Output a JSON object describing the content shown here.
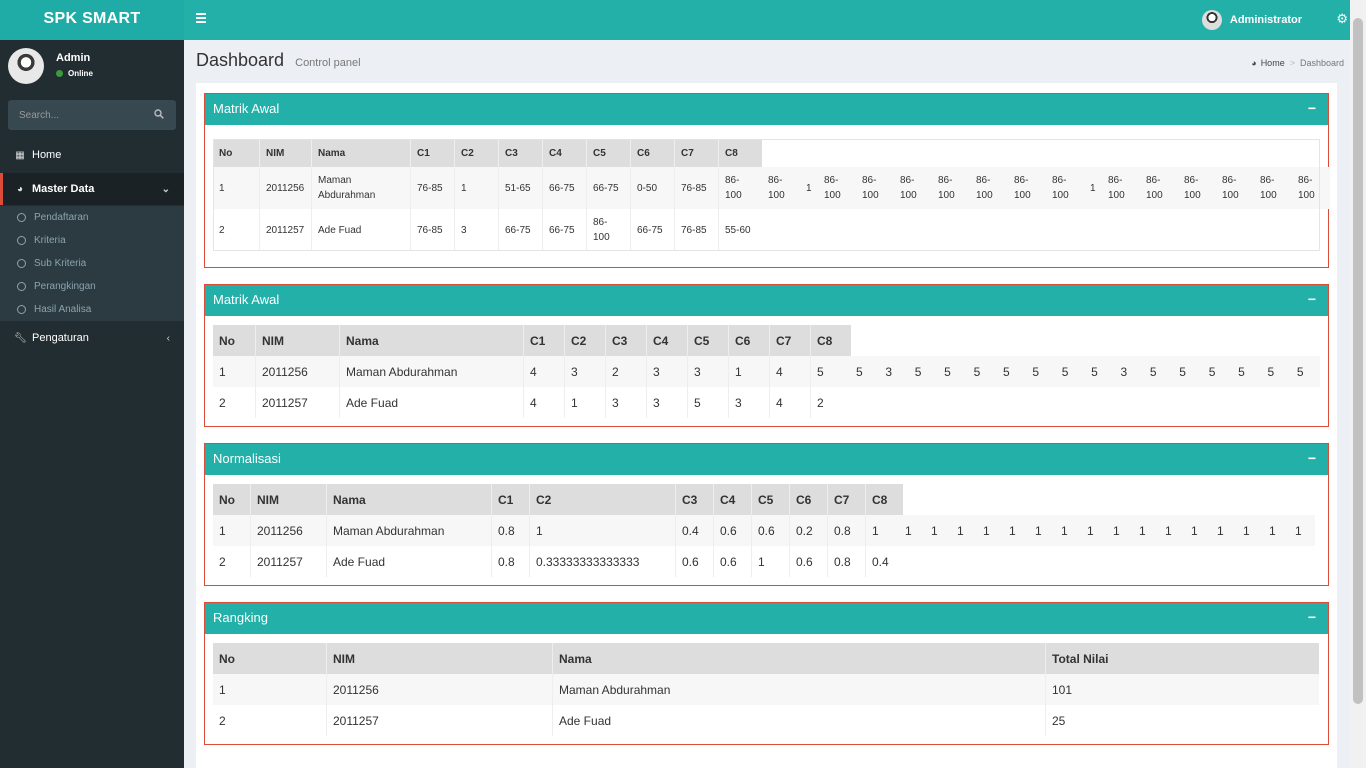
{
  "app": {
    "brand": "SPK SMART"
  },
  "navbar": {
    "user_label": "Administrator"
  },
  "sidebar": {
    "user": {
      "name": "Admin",
      "status": "Online"
    },
    "search_placeholder": "Search...",
    "home_label": "Home",
    "master_label": "Master Data",
    "submenu": [
      "Pendaftaran",
      "Kriteria",
      "Sub Kriteria",
      "Perangkingan",
      "Hasil Analisa"
    ],
    "settings_label": "Pengaturan"
  },
  "page": {
    "title": "Dashboard",
    "subtitle": "Control panel"
  },
  "breadcrumb": {
    "home": "Home",
    "current": "Dashboard"
  },
  "boxes": {
    "matrik_awal_1": {
      "title": "Matrik Awal",
      "headers": [
        "No",
        "NIM",
        "Nama",
        "C1",
        "C2",
        "C3",
        "C4",
        "C5",
        "C6",
        "C7",
        "C8"
      ],
      "rows": [
        [
          "1",
          "2011256",
          "Maman Abdurahman",
          "76-85",
          "1",
          "51-65",
          "66-75",
          "66-75",
          "0-50",
          "76-85",
          "86-100"
        ],
        [
          "2",
          "2011257",
          "Ade Fuad",
          "76-85",
          "3",
          "66-75",
          "66-75",
          "86-100",
          "66-75",
          "76-85",
          "55-60"
        ]
      ],
      "extra": [
        "86-100",
        "1",
        "86-100",
        "86-100",
        "86-100",
        "86-100",
        "86-100",
        "86-100",
        "86-100",
        "1",
        "86-100",
        "86-100",
        "86-100",
        "86-100",
        "86-100",
        "86-100"
      ]
    },
    "matrik_awal_2": {
      "title": "Matrik Awal",
      "headers": [
        "No",
        "NIM",
        "Nama",
        "C1",
        "C2",
        "C3",
        "C4",
        "C5",
        "C6",
        "C7",
        "C8"
      ],
      "rows": [
        [
          "1",
          "2011256",
          "Maman Abdurahman",
          "4",
          "3",
          "2",
          "3",
          "3",
          "1",
          "4",
          "5"
        ],
        [
          "2",
          "2011257",
          "Ade Fuad",
          "4",
          "1",
          "3",
          "3",
          "5",
          "3",
          "4",
          "2"
        ]
      ],
      "extra": [
        "5",
        "3",
        "5",
        "5",
        "5",
        "5",
        "5",
        "5",
        "5",
        "3",
        "5",
        "5",
        "5",
        "5",
        "5",
        "5"
      ]
    },
    "normalisasi": {
      "title": "Normalisasi",
      "headers": [
        "No",
        "NIM",
        "Nama",
        "C1",
        "C2",
        "C3",
        "C4",
        "C5",
        "C6",
        "C7",
        "C8"
      ],
      "rows": [
        [
          "1",
          "2011256",
          "Maman Abdurahman",
          "0.8",
          "1",
          "0.4",
          "0.6",
          "0.6",
          "0.2",
          "0.8",
          "1"
        ],
        [
          "2",
          "2011257",
          "Ade Fuad",
          "0.8",
          "0.33333333333333",
          "0.6",
          "0.6",
          "1",
          "0.6",
          "0.8",
          "0.4"
        ]
      ],
      "extra": [
        "1",
        "1",
        "1",
        "1",
        "1",
        "1",
        "1",
        "1",
        "1",
        "1",
        "1",
        "1",
        "1",
        "1",
        "1",
        "1"
      ]
    },
    "rangking": {
      "title": "Rangking",
      "headers": [
        "No",
        "NIM",
        "Nama",
        "Total Nilai"
      ],
      "rows": [
        [
          "1",
          "2011256",
          "Maman Abdurahman",
          "101"
        ],
        [
          "2",
          "2011257",
          "Ade Fuad",
          "25"
        ]
      ]
    }
  }
}
